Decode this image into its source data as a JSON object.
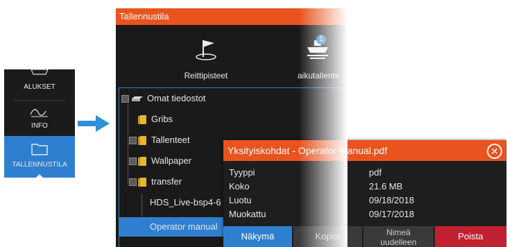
{
  "nav": {
    "items": [
      {
        "label": "ALUKSET"
      },
      {
        "label": "INFO"
      },
      {
        "label": "TALLENNUSTILA"
      }
    ]
  },
  "main": {
    "title": "Tallennustila",
    "tools": [
      {
        "label": "Reittipisteet",
        "icon": "waypoint-flag-icon"
      },
      {
        "label": "aikutallente",
        "icon": "boat-recording-icon",
        "badge": "1"
      }
    ],
    "tree": [
      {
        "label": "Omat tiedostot",
        "icon": "drive-icon",
        "expanded": true
      },
      {
        "label": "Gribs",
        "icon": "folder-icon"
      },
      {
        "label": "Tallenteet",
        "icon": "folder-icon",
        "expanded": false
      },
      {
        "label": "Wallpaper",
        "icon": "folder-icon",
        "expanded": false
      },
      {
        "label": "transfer",
        "icon": "folder-icon",
        "expanded": true
      },
      {
        "label": "HDS_Live-bsp4-6"
      },
      {
        "label": "Operator manual"
      }
    ]
  },
  "dialog": {
    "title": "Yksityiskohdat - Operator manual.pdf",
    "properties": [
      {
        "label": "Tyyppi",
        "value": "pdf"
      },
      {
        "label": "Koko",
        "value": "21.6 MB"
      },
      {
        "label": "Luotu",
        "value": "09/18/2018"
      },
      {
        "label": "Muokattu",
        "value": "09/17/2018"
      }
    ],
    "buttons": {
      "view": "Näkymä",
      "copy": "Kopioi",
      "rename_line1": "Nimeä",
      "rename_line2": "uudelleen",
      "delete": "Poista"
    }
  },
  "colors": {
    "accent_orange": "#e8531e",
    "accent_blue": "#2f7fd0",
    "delete_red": "#c0202f",
    "panel_bg": "#1a1a1a"
  }
}
